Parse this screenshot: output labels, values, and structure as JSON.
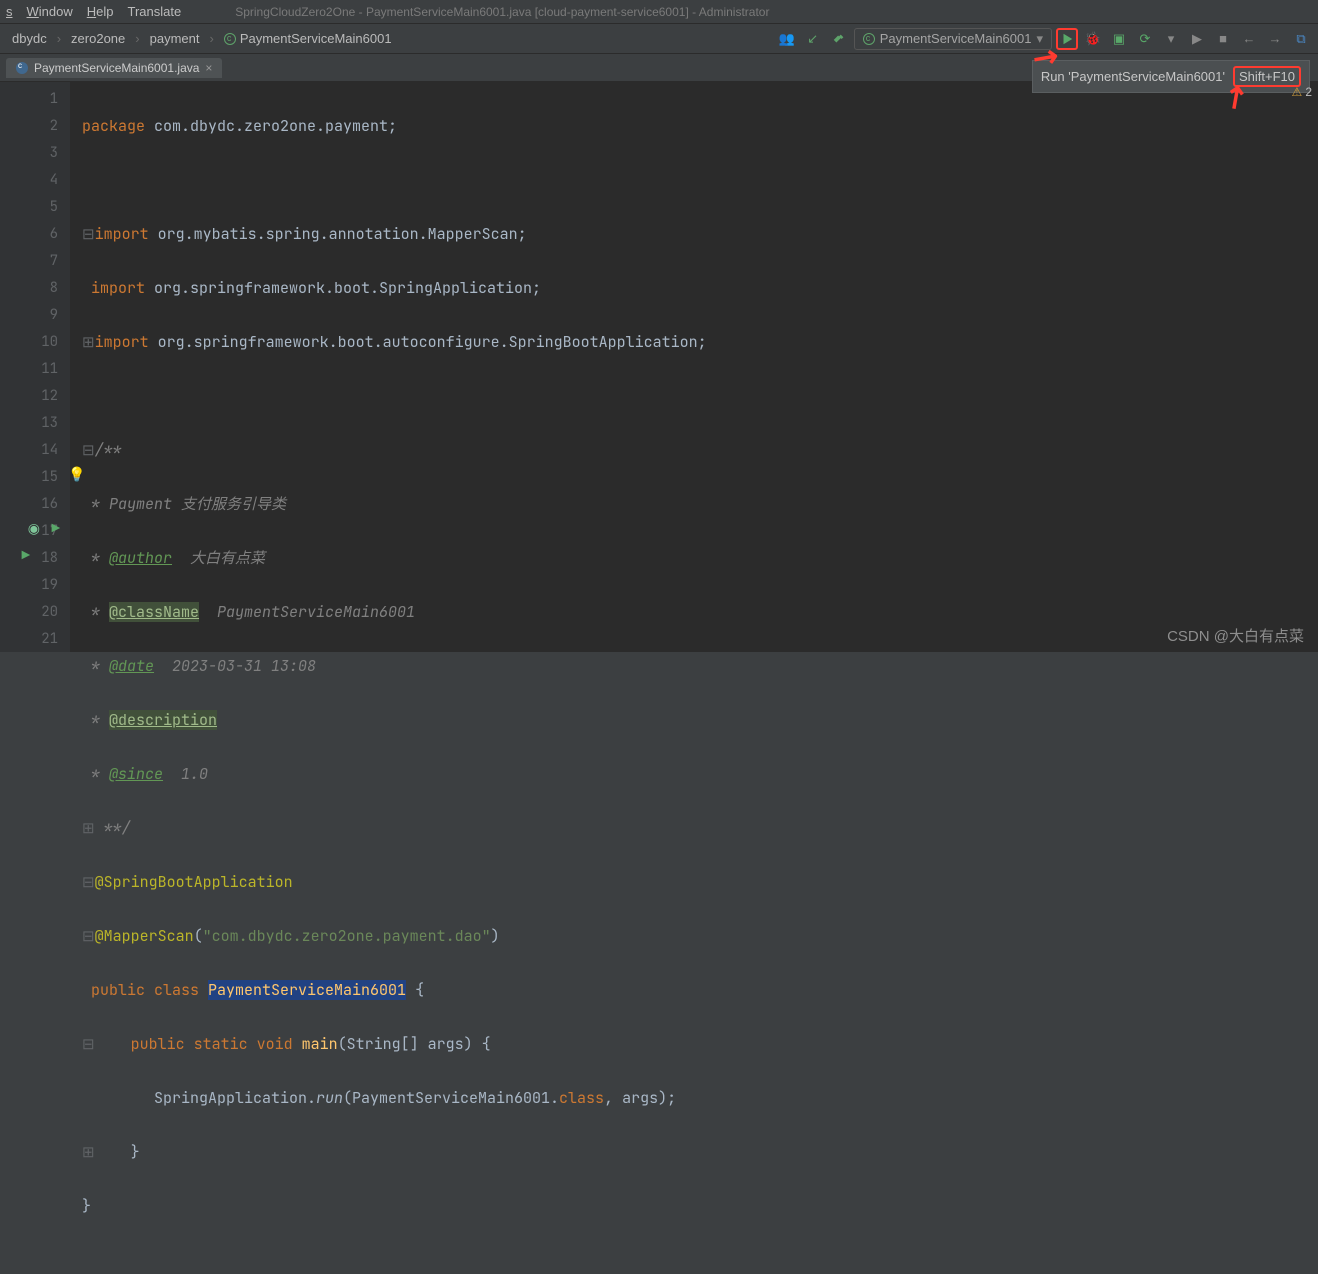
{
  "menu": {
    "tools": "s",
    "window": "Window",
    "help": "Help",
    "translate": "Translate"
  },
  "title": "SpringCloudZero2One - PaymentServiceMain6001.java [cloud-payment-service6001] - Administrator",
  "breadcrumbs": {
    "b1": "dbydc",
    "b2": "zero2one",
    "b3": "payment",
    "b4": "PaymentServiceMain6001"
  },
  "runConfig": {
    "selected": "PaymentServiceMain6001"
  },
  "tab": {
    "name": "PaymentServiceMain6001.java"
  },
  "tooltip": {
    "text": "Run 'PaymentServiceMain6001'",
    "shortcut": "Shift+F10"
  },
  "warnings": {
    "count": "2"
  },
  "gutter": {
    "lines": [
      "1",
      "2",
      "3",
      "4",
      "5",
      "6",
      "7",
      "8",
      "9",
      "10",
      "11",
      "12",
      "13",
      "14",
      "15",
      "16",
      "17",
      "18",
      "19",
      "20",
      "21"
    ]
  },
  "code": {
    "l1_kw": "package ",
    "l1_pkg": "com.dbydc.zero2one.payment",
    "l1_end": ";",
    "l3_kw": "import ",
    "l3_pkg": "org.mybatis.spring.annotation.MapperScan",
    "l3_end": ";",
    "l4_kw": "import ",
    "l4_pkg": "org.springframework.boot.SpringApplication",
    "l4_end": ";",
    "l5_kw": "import ",
    "l5_pkg": "org.springframework.boot.autoconfigure.",
    "l5_cls": "SpringBootApplication",
    "l5_end": ";",
    "l7": "/**",
    "l8_pre": " * ",
    "l8_txt": "Payment 支付服务引导类",
    "l9_pre": " * ",
    "l9_tag": "@author",
    "l9_txt": "  大白有点菜",
    "l10_pre": " * ",
    "l10_tag": "@className",
    "l10_txt": "  PaymentServiceMain6001",
    "l11_pre": " * ",
    "l11_tag": "@date",
    "l11_txt": "  2023-03-31 13:08",
    "l12_pre": " * ",
    "l12_tag": "@description",
    "l13_pre": " * ",
    "l13_tag": "@since",
    "l13_txt": "  1.0",
    "l14": " **/",
    "l15": "@SpringBootApplication",
    "l16_ann": "@MapperScan",
    "l16_op": "(",
    "l16_str": "\"com.dbydc.zero2one.payment.dao\"",
    "l16_cl": ")",
    "l17_kw1": "public ",
    "l17_kw2": "class ",
    "l17_cls": "PaymentServiceMain6001",
    "l17_end": " {",
    "l18_kw1": "    public ",
    "l18_kw2": "static ",
    "l18_kw3": "void ",
    "l18_fn": "main",
    "l18_sig": "(String[] args) {",
    "l19_pre": "        SpringApplication.",
    "l19_run": "run",
    "l19_op": "(PaymentServiceMain6001.",
    "l19_kw": "class",
    "l19_end": ", args);",
    "l20": "    }",
    "l21": "}"
  },
  "watermark": "CSDN @大白有点菜"
}
